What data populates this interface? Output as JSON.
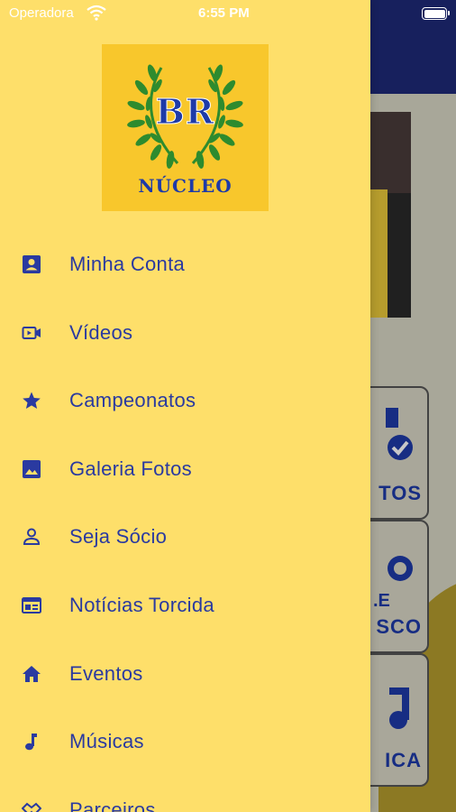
{
  "status_bar": {
    "carrier": "Operadora",
    "time": "6:55 PM"
  },
  "logo": {
    "monogram": "BR",
    "name": "NÚCLEO"
  },
  "menu": {
    "items": [
      {
        "label": "Minha Conta",
        "icon": "account-box-icon"
      },
      {
        "label": "Vídeos",
        "icon": "video-icon"
      },
      {
        "label": "Campeonatos",
        "icon": "star-icon"
      },
      {
        "label": "Galeria Fotos",
        "icon": "image-icon"
      },
      {
        "label": "Seja Sócio",
        "icon": "person-icon"
      },
      {
        "label": "Notícias Torcida",
        "icon": "news-icon"
      },
      {
        "label": "Eventos",
        "icon": "home-icon"
      },
      {
        "label": "Músicas",
        "icon": "music-note-icon"
      },
      {
        "label": "Parceiros",
        "icon": "handshake-icon"
      }
    ]
  },
  "background": {
    "card_labels": [
      "TOS",
      ".E",
      "SCO",
      "ICA"
    ]
  },
  "colors": {
    "drawer_bg": "#fedf6a",
    "accent_blue": "#2a3aa0",
    "header_navy": "#1e2a78",
    "logo_bg": "#f8c72c",
    "laurel_green": "#2e8b2e"
  }
}
